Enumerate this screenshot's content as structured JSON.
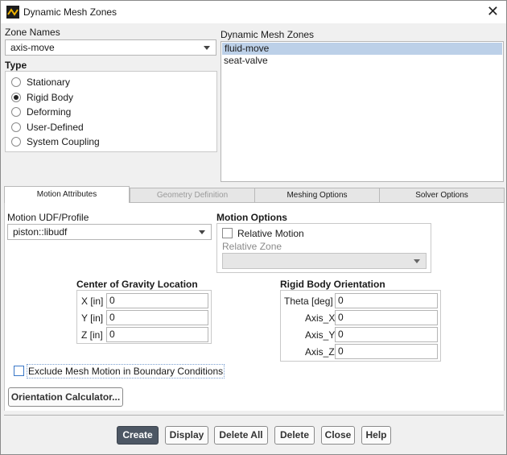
{
  "window": {
    "title": "Dynamic Mesh Zones"
  },
  "zone_names": {
    "label": "Zone Names",
    "value": "axis-move"
  },
  "dynamic_mesh_zones": {
    "label": "Dynamic Mesh Zones",
    "items": [
      "fluid-move",
      "seat-valve"
    ],
    "selected": "fluid-move"
  },
  "type": {
    "label": "Type",
    "options": [
      "Stationary",
      "Rigid Body",
      "Deforming",
      "User-Defined",
      "System Coupling"
    ],
    "selected": "Rigid Body"
  },
  "tabs": [
    "Motion Attributes",
    "Geometry Definition",
    "Meshing Options",
    "Solver Options"
  ],
  "motion": {
    "udf_label": "Motion UDF/Profile",
    "udf_value": "piston::libudf",
    "options_label": "Motion Options",
    "relative_motion_label": "Relative Motion",
    "relative_zone_label": "Relative Zone",
    "relative_zone_value": ""
  },
  "cog": {
    "label": "Center of Gravity Location",
    "x_label": "X [in]",
    "x": "0",
    "y_label": "Y [in]",
    "y": "0",
    "z_label": "Z [in]",
    "z": "0"
  },
  "orientation": {
    "label": "Rigid Body Orientation",
    "theta_label": "Theta [deg]",
    "theta": "0",
    "axis_x_label": "Axis_X",
    "axis_x": "0",
    "axis_y_label": "Axis_Y",
    "axis_y": "0",
    "axis_z_label": "Axis_Z",
    "axis_z": "0"
  },
  "exclude_label": "Exclude Mesh Motion in Boundary Conditions",
  "orientation_calc_label": "Orientation Calculator...",
  "buttons": {
    "create": "Create",
    "display": "Display",
    "delete_all": "Delete All",
    "delete": "Delete",
    "close": "Close",
    "help": "Help"
  },
  "icons": {
    "app": "ansys-app-icon",
    "close": "close-icon",
    "dropdown": "chevron-down-icon"
  },
  "colors": {
    "primary_button": "#4d5764",
    "selection": "#bcd0e8"
  }
}
